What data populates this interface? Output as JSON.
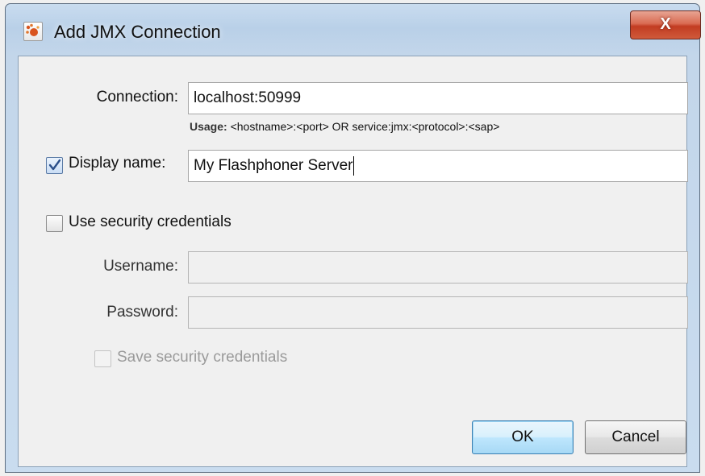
{
  "window": {
    "title": "Add JMX Connection",
    "app_icon": "visualvm-app-icon",
    "close_glyph": "X"
  },
  "form": {
    "connection": {
      "label": "Connection:",
      "value": "localhost:50999",
      "usage_prefix": "Usage:",
      "usage_text": " <hostname>:<port> OR service:jmx:<protocol>:<sap>"
    },
    "display_name": {
      "label": "Display name:",
      "checked": true,
      "value": "My Flashphoner Server"
    },
    "use_security": {
      "label": "Use security credentials",
      "checked": false
    },
    "username": {
      "label": "Username:",
      "value": ""
    },
    "password": {
      "label": "Password:",
      "value": ""
    },
    "save_security": {
      "label": "Save security credentials",
      "checked": false,
      "enabled": false
    }
  },
  "buttons": {
    "ok": "OK",
    "cancel": "Cancel"
  },
  "colors": {
    "title_bar": "#b9d0e8",
    "close_button": "#c23c22",
    "dialog_bg": "#f0f0f0",
    "default_button": "#bee6fd"
  }
}
